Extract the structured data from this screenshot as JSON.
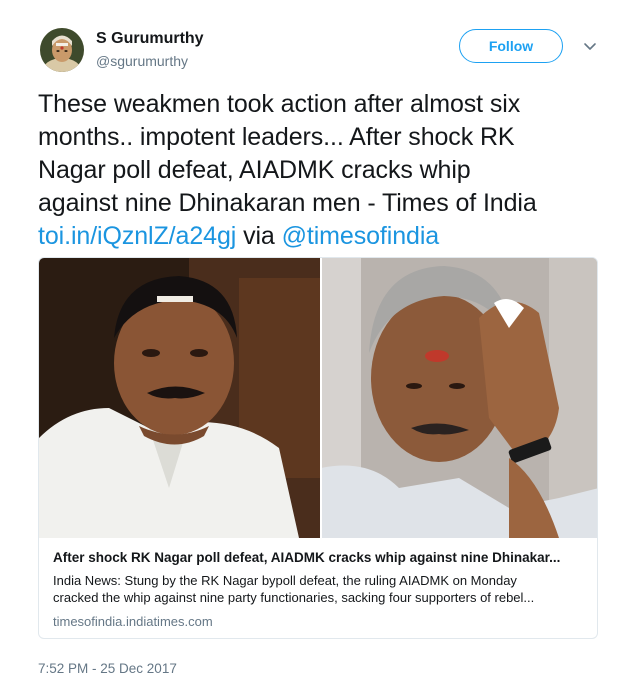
{
  "author": {
    "name": "S Gurumurthy",
    "handle": "@sgurumurthy",
    "avatar_icon": "portrait-avatar"
  },
  "follow_label": "Follow",
  "menu_icon": "chevron-down-icon",
  "tweet": {
    "text_lines": [
      "These weakmen took action after almost six",
      "months.. impotent leaders... After shock RK",
      "Nagar poll defeat, AIADMK cracks whip",
      "against nine Dhinakaran men - Times of India"
    ],
    "link": "toi.in/iQznlZ/a24gj",
    "via": "via",
    "mention": "@timesofindia"
  },
  "card": {
    "title": "After shock RK Nagar poll defeat, AIADMK cracks whip against nine Dhinakar...",
    "description_lines": [
      "India News: Stung by the RK Nagar bypoll defeat, the ruling AIADMK on Monday",
      "cracked the whip against nine party functionaries, sacking four supporters of rebel..."
    ],
    "domain": "timesofindia.indiatimes.com"
  },
  "timestamp": "7:52 PM - 25 Dec 2017",
  "colors": {
    "accent": "#1da1f2",
    "link": "#1b95e0",
    "secondary_text": "#657786",
    "border": "#e1e8ed"
  }
}
